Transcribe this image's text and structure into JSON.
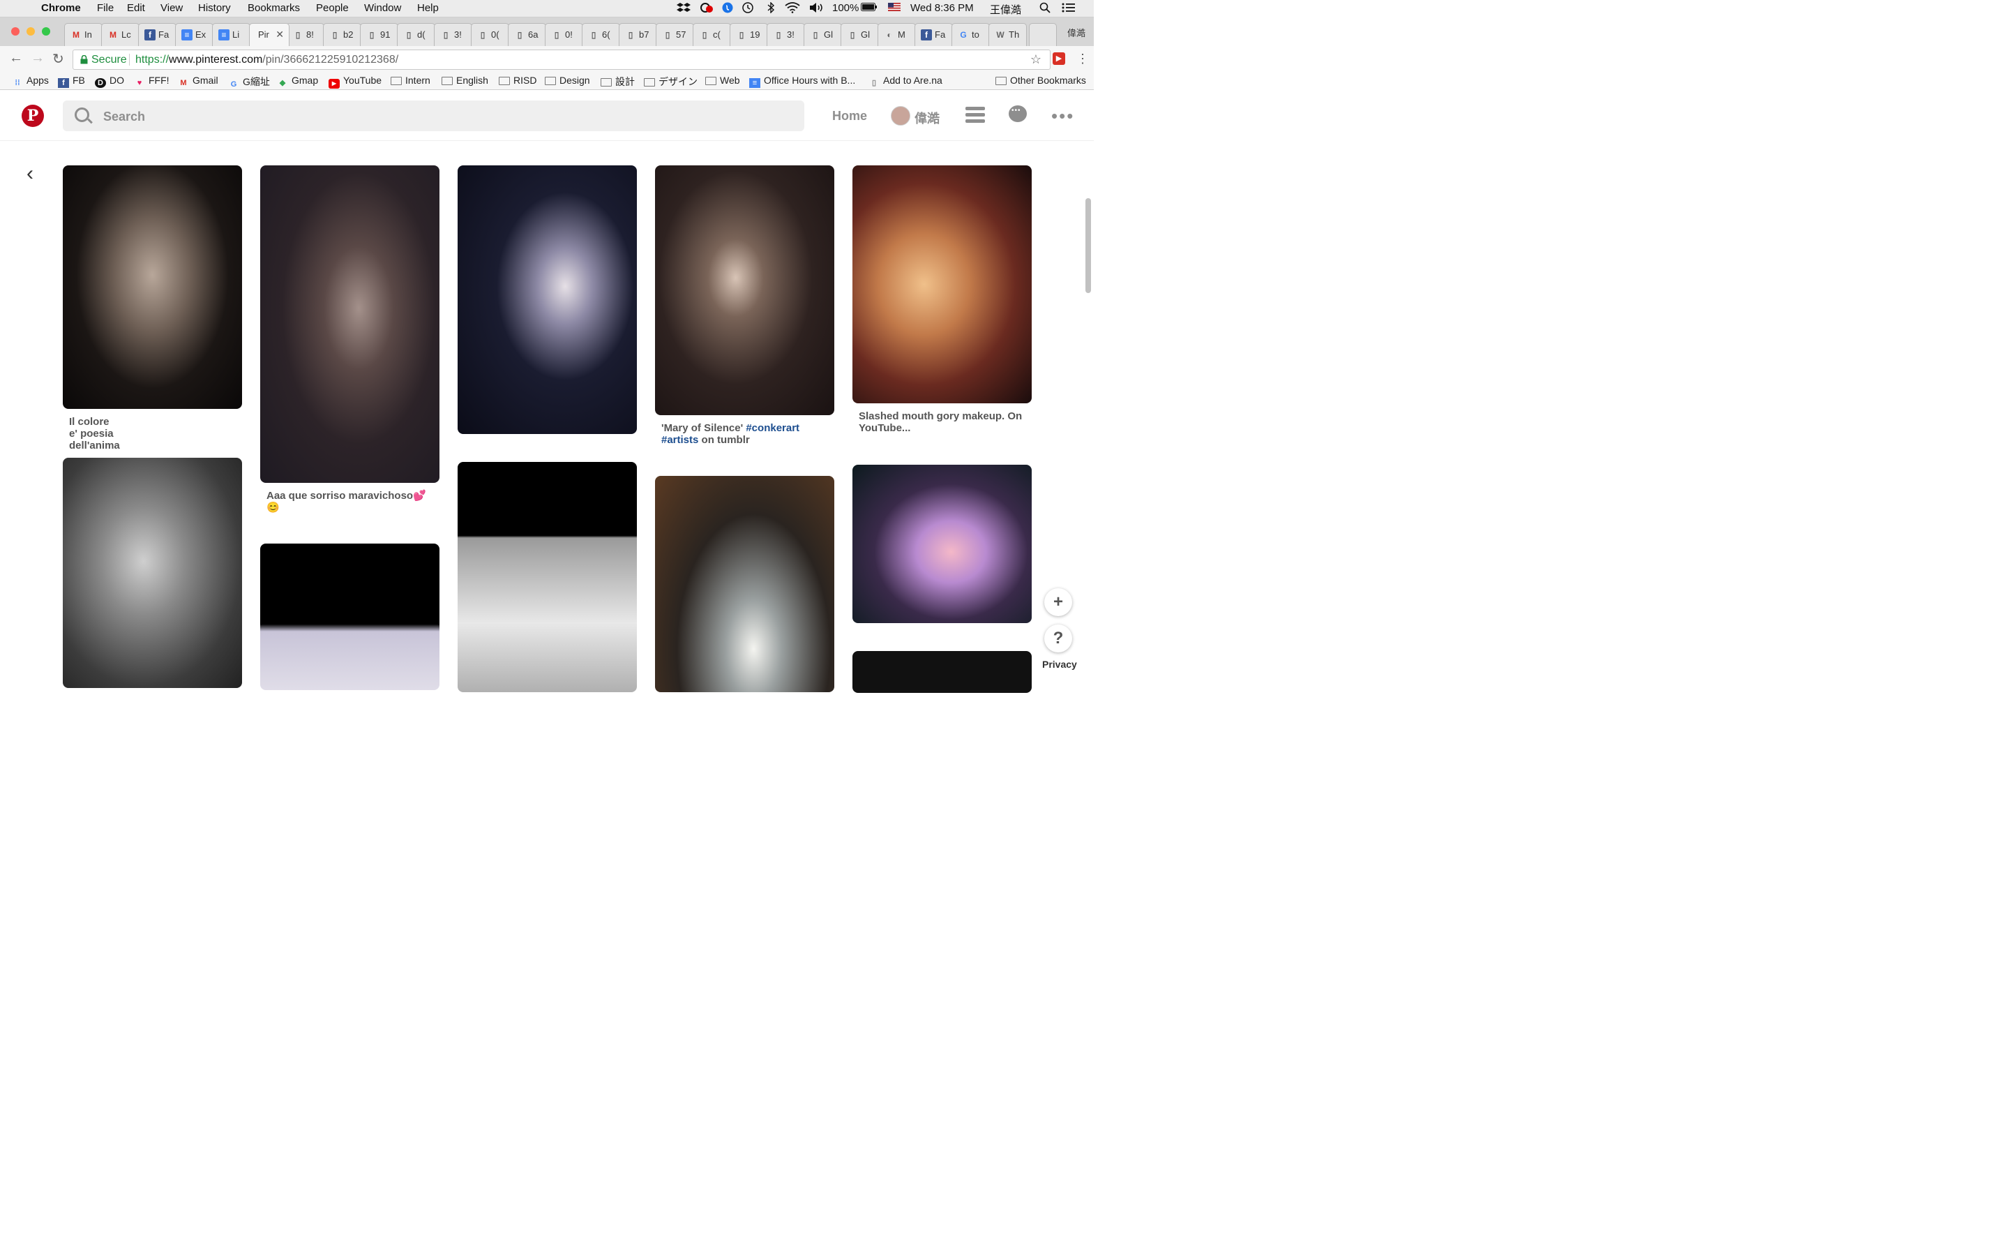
{
  "menubar": {
    "app": "Chrome",
    "items": [
      "File",
      "Edit",
      "View",
      "History",
      "Bookmarks",
      "People",
      "Window",
      "Help"
    ],
    "battery": "100%",
    "datetime": "Wed 8:36 PM",
    "user": "王偉澔"
  },
  "tabs": [
    {
      "icon": "M",
      "label": "In"
    },
    {
      "icon": "M",
      "label": "Lc"
    },
    {
      "icon": "f",
      "label": "Fa"
    },
    {
      "icon": "≡",
      "label": "Ex"
    },
    {
      "icon": "≡",
      "label": "Li"
    },
    {
      "icon": "",
      "label": "Pir",
      "active": true
    },
    {
      "icon": "▯",
      "label": "8!"
    },
    {
      "icon": "▯",
      "label": "b2"
    },
    {
      "icon": "▯",
      "label": "91"
    },
    {
      "icon": "▯",
      "label": "d("
    },
    {
      "icon": "▯",
      "label": "3!"
    },
    {
      "icon": "▯",
      "label": "0("
    },
    {
      "icon": "▯",
      "label": "6a"
    },
    {
      "icon": "▯",
      "label": "0!"
    },
    {
      "icon": "▯",
      "label": "6("
    },
    {
      "icon": "▯",
      "label": "b7"
    },
    {
      "icon": "▯",
      "label": "57"
    },
    {
      "icon": "▯",
      "label": "c("
    },
    {
      "icon": "▯",
      "label": "19"
    },
    {
      "icon": "▯",
      "label": "3!"
    },
    {
      "icon": "▯",
      "label": "Gl"
    },
    {
      "icon": "▯",
      "label": "Gl"
    },
    {
      "icon": "◐",
      "label": "M"
    },
    {
      "icon": "f",
      "label": "Fa"
    },
    {
      "icon": "G",
      "label": "to"
    },
    {
      "icon": "W",
      "label": "Th"
    },
    {
      "icon": "",
      "label": ""
    }
  ],
  "profile_name": "偉澔",
  "omnibox": {
    "secure_label": "Secure",
    "url_prefix": "https://",
    "url_domain": "www.pinterest.com",
    "url_path": "/pin/366621225910212368/"
  },
  "bookmarks": [
    {
      "icon": "apps",
      "label": "Apps"
    },
    {
      "icon": "facebook",
      "label": "FB"
    },
    {
      "icon": "do",
      "label": "DO"
    },
    {
      "icon": "heart",
      "label": "FFF!"
    },
    {
      "icon": "gmail",
      "label": "Gmail"
    },
    {
      "icon": "google",
      "label": "G縮址"
    },
    {
      "icon": "maps",
      "label": "Gmap"
    },
    {
      "icon": "youtube",
      "label": "YouTube"
    },
    {
      "icon": "folder",
      "label": "Intern"
    },
    {
      "icon": "folder",
      "label": "English"
    },
    {
      "icon": "folder",
      "label": "RISD"
    },
    {
      "icon": "folder",
      "label": "Design"
    },
    {
      "icon": "folder",
      "label": "設計"
    },
    {
      "icon": "folder",
      "label": "デザイン"
    },
    {
      "icon": "folder",
      "label": "Web"
    },
    {
      "icon": "docs",
      "label": "Office Hours with B..."
    },
    {
      "icon": "page",
      "label": "Add to Are.na"
    }
  ],
  "other_bookmarks": "Other Bookmarks",
  "pinterest": {
    "search_placeholder": "Search",
    "home_label": "Home",
    "user_name": "偉澔",
    "privacy_label": "Privacy",
    "add_icon": "+",
    "help_icon": "?"
  },
  "pins": [
    {
      "caption": "Il colore e' poesia dell'anima"
    },
    {
      "caption": "Aaa que sorriso maravichoso💕 😊"
    },
    {
      "caption": ""
    },
    {
      "caption_parts": [
        "'Mary of Silence' ",
        "#conkerart",
        " ",
        "#artists",
        " on tumblr"
      ]
    },
    {
      "caption": "Slashed mouth gory makeup. On YouTube..."
    }
  ],
  "colors": {
    "pinterest_red": "#bd081c",
    "hashtag": "#1d4e8f",
    "secure_green": "#1e8e3e"
  }
}
